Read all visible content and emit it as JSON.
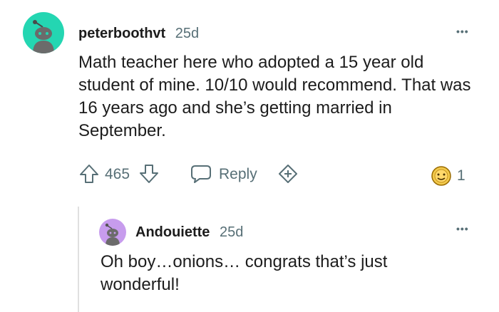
{
  "comment": {
    "username": "peterboothvt",
    "age": "25d",
    "more": "•••",
    "body": "Math teacher here who adopted a 15 year old student of mine. 10/10 would recommend. That was 16 years ago and she’s getting married in September.",
    "votes": "465",
    "reply_label": "Reply",
    "award_count": "1",
    "avatar_color": "#24d6b2"
  },
  "reply": {
    "username": "Andouiette",
    "age": "25d",
    "more": "•••",
    "body": "Oh boy…onions… congrats that’s just wonderful!",
    "avatar_color": "#c79ced"
  }
}
